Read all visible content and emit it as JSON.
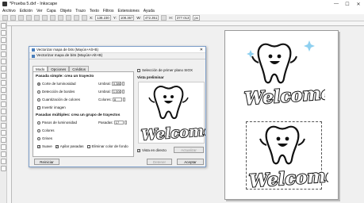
{
  "window": {
    "title": "*Prueba 5.dxf - Inkscape",
    "controls": [
      "—",
      "☐",
      "✕"
    ]
  },
  "menu": [
    "Archivo",
    "Edición",
    "Ver",
    "Capa",
    "Objeto",
    "Trazo",
    "Texto",
    "Filtros",
    "Extensiones",
    "Ayuda"
  ],
  "toolbar": {
    "x_label": "X:",
    "x_value": "138.230",
    "y_label": "Y:",
    "y_value": "108.367",
    "w_label": "W:",
    "w_value": "472.351",
    "h_label": "H:",
    "h_value": "377.013",
    "unit": "px"
  },
  "dialog": {
    "title": "Vectorizar mapa de bits (Mayús+Alt+B)",
    "header": "Vectorizar mapa de bits (Mayús+Alt+B)",
    "tabs": [
      "Modo",
      "Opciones",
      "Créditos"
    ],
    "single_scan": {
      "heading": "Pasada simple: crea un trayecto",
      "options": [
        {
          "label": "Corte de luminosidad",
          "param": "Umbral:",
          "value": "0.380",
          "selected": true
        },
        {
          "label": "Detección de bordes",
          "param": "Umbral:",
          "value": "1.000",
          "selected": false
        },
        {
          "label": "Cuantización de colores",
          "param": "Colores:",
          "value": "8",
          "selected": false
        }
      ],
      "invert": "Invertir imagen"
    },
    "multi_scan": {
      "heading": "Pasadas múltiples: crea un grupo de trayectos",
      "options": [
        "Pasos de luminosidad",
        "Colores",
        "Grises"
      ],
      "passes_label": "Pasadas:",
      "passes_value": "17",
      "checks": [
        {
          "label": "Suave",
          "checked": true
        },
        {
          "label": "Apilar pasadas",
          "checked": true
        },
        {
          "label": "Eliminar color de fondo",
          "checked": false
        }
      ]
    },
    "foreground_select": "Selección de primer plano SIOX",
    "preview_label": "Vista preliminar",
    "live_preview": "Vista en directo",
    "update_button": "Actualizar",
    "reset_button": "Reiniciar",
    "stop_button": "Detener",
    "ok_button": "Aceptar"
  },
  "artwork": {
    "text": "Welcome"
  }
}
